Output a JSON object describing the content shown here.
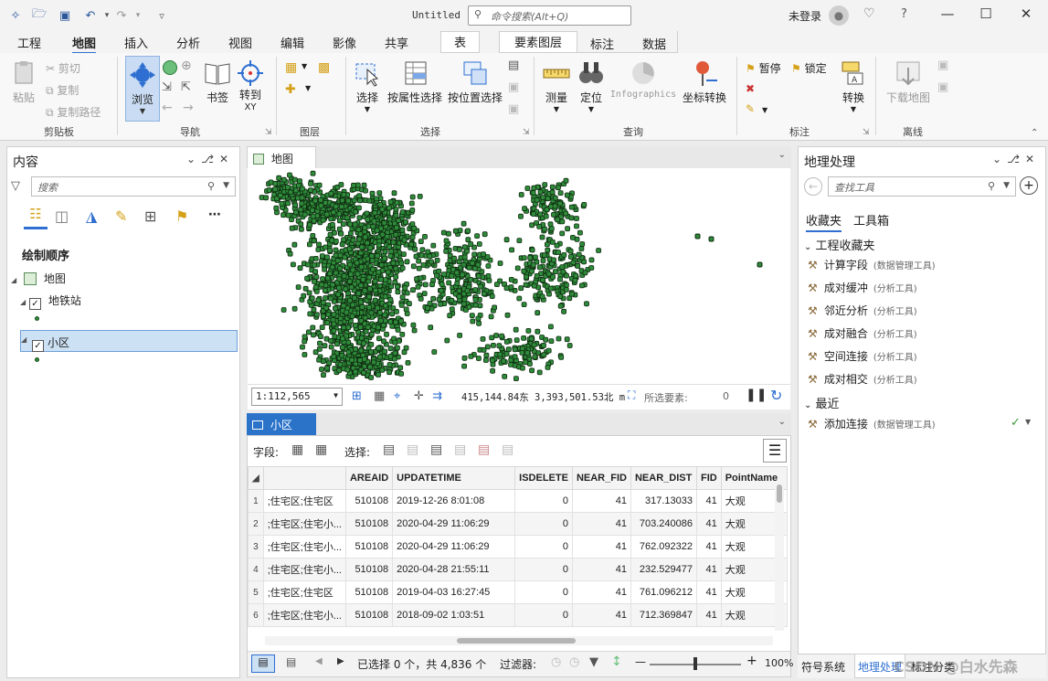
{
  "window": {
    "title": "Untitled",
    "search_placeholder": "命令搜索(Alt+Q)",
    "user": "未登录",
    "help": "?"
  },
  "ribbon_tabs": [
    {
      "label": "工程"
    },
    {
      "label": "地图",
      "active": true
    },
    {
      "label": "插入"
    },
    {
      "label": "分析"
    },
    {
      "label": "视图"
    },
    {
      "label": "编辑"
    },
    {
      "label": "影像"
    },
    {
      "label": "共享"
    }
  ],
  "context_tabs": {
    "table": "表",
    "feature_layer": "要素图层",
    "labeling": "标注",
    "data": "数据"
  },
  "ribbon": {
    "clipboard": {
      "paste": "粘贴",
      "cut": "剪切",
      "copy": "复制",
      "copy_path": "复制路径",
      "group": "剪贴板"
    },
    "navigate": {
      "explore": "浏览",
      "bookmarks": "书签",
      "goto_line1": "转到",
      "goto_line2": "XY",
      "group": "导航"
    },
    "layer": {
      "group": "图层"
    },
    "selection": {
      "select": "选择",
      "by_attr": "按属性选择",
      "by_loc": "按位置选择",
      "group": "选择"
    },
    "inquiry": {
      "measure": "测量",
      "locate": "定位",
      "infographics": "Infographics",
      "convert_coords": "坐标转换",
      "group": "查询"
    },
    "labeling": {
      "pause": "暂停",
      "lock": "锁定",
      "convert": "转换",
      "group": "标注"
    },
    "offline": {
      "download": "下载地图",
      "group": "离线"
    }
  },
  "contents": {
    "title": "内容",
    "search_placeholder": "搜索",
    "draw_order": "绘制顺序",
    "map": "地图",
    "layers": [
      {
        "name": "地铁站",
        "checked": true,
        "selected": false
      },
      {
        "name": "小区",
        "checked": true,
        "selected": true
      }
    ]
  },
  "map_view": {
    "tab": "地图",
    "scale": "1:112,565",
    "coords": "415,144.84东 3,393,501.53北 m",
    "selected_features_label": "所选要素:",
    "selected_features_count": "0"
  },
  "table_view": {
    "tab": "小区",
    "fields_label": "字段:",
    "select_label": "选择:",
    "columns": [
      "",
      "AREAID",
      "UPDATETIME",
      "ISDELETE",
      "NEAR_FID",
      "NEAR_DIST",
      "FID",
      "PointName"
    ],
    "rows": [
      {
        "n": "1",
        "c0": ";住宅区;住宅区",
        "areaid": "510108",
        "time": "2019-12-26 8:01:08",
        "isdel": "0",
        "nfid": "41",
        "ndist": "317.13033",
        "fid": "41",
        "pname": "大观"
      },
      {
        "n": "2",
        "c0": ";住宅区;住宅小...",
        "areaid": "510108",
        "time": "2020-04-29 11:06:29",
        "isdel": "0",
        "nfid": "41",
        "ndist": "703.240086",
        "fid": "41",
        "pname": "大观"
      },
      {
        "n": "3",
        "c0": ";住宅区;住宅小...",
        "areaid": "510108",
        "time": "2020-04-29 11:06:29",
        "isdel": "0",
        "nfid": "41",
        "ndist": "762.092322",
        "fid": "41",
        "pname": "大观"
      },
      {
        "n": "4",
        "c0": ";住宅区;住宅小...",
        "areaid": "510108",
        "time": "2020-04-28 21:55:11",
        "isdel": "0",
        "nfid": "41",
        "ndist": "232.529477",
        "fid": "41",
        "pname": "大观"
      },
      {
        "n": "5",
        "c0": ";住宅区;住宅区",
        "areaid": "510108",
        "time": "2019-04-03 16:27:45",
        "isdel": "0",
        "nfid": "41",
        "ndist": "761.096212",
        "fid": "41",
        "pname": "大观"
      },
      {
        "n": "6",
        "c0": ";住宅区;住宅小...",
        "areaid": "510108",
        "time": "2018-09-02 1:03:51",
        "isdel": "0",
        "nfid": "41",
        "ndist": "712.369847",
        "fid": "41",
        "pname": "大观"
      }
    ],
    "status": "已选择 0 个，共 4,836 个",
    "filter_label": "过滤器:",
    "zoom": "100%"
  },
  "geoprocessing": {
    "title": "地理处理",
    "search_placeholder": "查找工具",
    "tabs": {
      "favorites": "收藏夹",
      "toolboxes": "工具箱"
    },
    "project_favorites": "工程收藏夹",
    "tools": [
      {
        "name": "计算字段",
        "box": "(数据管理工具)"
      },
      {
        "name": "成对缓冲",
        "box": "(分析工具)"
      },
      {
        "name": "邻近分析",
        "box": "(分析工具)"
      },
      {
        "name": "成对融合",
        "box": "(分析工具)"
      },
      {
        "name": "空间连接",
        "box": "(分析工具)"
      },
      {
        "name": "成对相交",
        "box": "(分析工具)"
      }
    ],
    "recent": "最近",
    "recent_tools": [
      {
        "name": "添加连接",
        "box": "(数据管理工具)"
      }
    ],
    "bottom_tabs": [
      "符号系统",
      "地理处理",
      "标注分类"
    ]
  },
  "watermark": "CSDN @白水先森",
  "colors": {
    "accent": "#2b73c9",
    "point_fill": "#2e8b3a",
    "point_stroke": "#0f2a10"
  }
}
